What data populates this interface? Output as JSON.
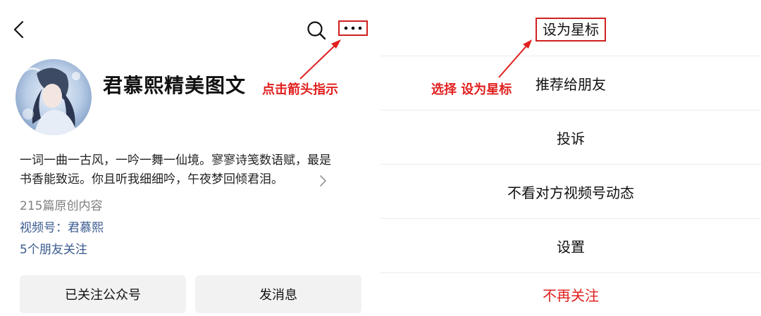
{
  "profile": {
    "account_name": "君慕熙精美图文",
    "bio_line1": "一词一曲一古风，一吟一舞一仙境。寥寥诗笺数语赋，最是",
    "bio_line2": "书香能致远。你且听我细细吟，午夜梦回倾君泪。",
    "article_count": "215篇原创内容",
    "channels_label": "视频号：",
    "channels_name": "君慕熙",
    "friends_follow": "5个朋友关注"
  },
  "buttons": {
    "followed": "已关注公众号",
    "message": "发消息"
  },
  "annotations": {
    "left": "点击箭头指示",
    "right": "选择 设为星标",
    "color": "#e0201f"
  },
  "menu": {
    "items": [
      {
        "label": "设为星标"
      },
      {
        "label": "推荐给朋友"
      },
      {
        "label": "投诉"
      },
      {
        "label": "不看对方视频号动态"
      },
      {
        "label": "设置"
      },
      {
        "label": "不再关注"
      }
    ],
    "danger_color": "#e0201f"
  },
  "icons": {
    "back": "chevron-left-icon",
    "search": "search-icon",
    "more": "more-dots-icon",
    "bio_expand": "chevron-right-icon"
  }
}
